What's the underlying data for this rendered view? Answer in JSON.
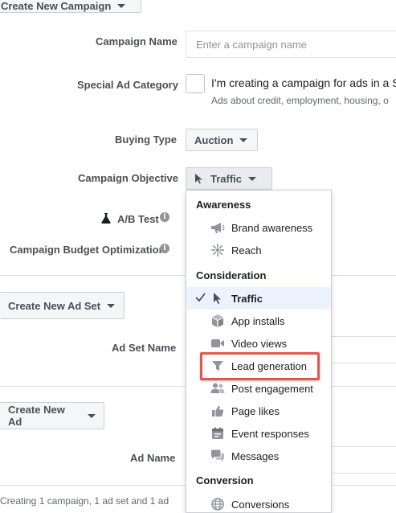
{
  "top_button": {
    "label": "Create New Campaign"
  },
  "campaign": {
    "name_label": "Campaign Name",
    "name_placeholder": "Enter a campaign name",
    "special_ad_label": "Special Ad Category",
    "special_ad_text": "I'm creating a campaign for ads in a Sp",
    "special_ad_subtext": "Ads about credit, employment, housing, o",
    "buying_type_label": "Buying Type",
    "buying_type_value": "Auction",
    "objective_label": "Campaign Objective",
    "objective_value": "Traffic",
    "ab_test_label": "A/B Test",
    "budget_opt_label": "Campaign Budget Optimization"
  },
  "ad_set": {
    "button_label": "Create New Ad Set",
    "name_label": "Ad Set Name"
  },
  "ad": {
    "button_label": "Create New Ad",
    "name_label": "Ad Name"
  },
  "footer": {
    "summary": "Creating 1 campaign, 1 ad set and 1 ad"
  },
  "objective_menu": {
    "groups": [
      {
        "heading": "Awareness",
        "items": [
          {
            "label": "Brand awareness",
            "icon": "megaphone-icon"
          },
          {
            "label": "Reach",
            "icon": "reach-icon"
          }
        ]
      },
      {
        "heading": "Consideration",
        "items": [
          {
            "label": "Traffic",
            "icon": "cursor-icon",
            "selected": true
          },
          {
            "label": "App installs",
            "icon": "box-icon"
          },
          {
            "label": "Video views",
            "icon": "video-camera-icon"
          },
          {
            "label": "Lead generation",
            "icon": "funnel-icon",
            "highlighted": true
          },
          {
            "label": "Post engagement",
            "icon": "people-icon"
          },
          {
            "label": "Page likes",
            "icon": "thumbs-up-icon"
          },
          {
            "label": "Event responses",
            "icon": "calendar-icon"
          },
          {
            "label": "Messages",
            "icon": "chat-bubbles-icon"
          }
        ]
      },
      {
        "heading": "Conversion",
        "items": [
          {
            "label": "Conversions",
            "icon": "globe-icon"
          }
        ]
      }
    ]
  },
  "colors": {
    "highlight": "#e2574c",
    "selected_bg": "#ecf3ff",
    "label": "#4b4f56",
    "icon": "#90949c"
  }
}
